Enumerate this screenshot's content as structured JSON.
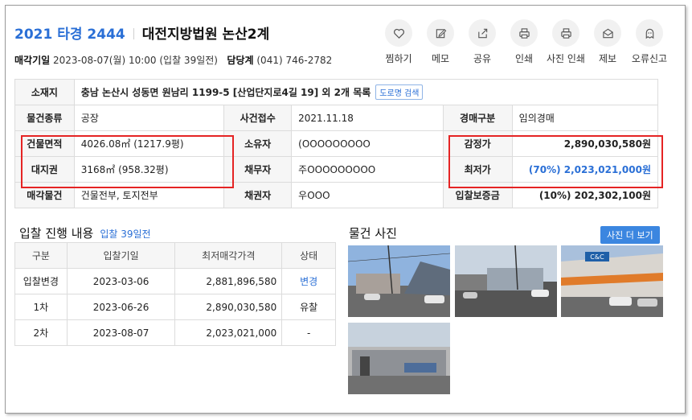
{
  "header": {
    "case_number": "2021 타경 2444",
    "court": "대전지방법원 논산2계",
    "sale_date_label": "매각기일",
    "sale_date_value": "2023-08-07(월) 10:00 (입찰 39일전)",
    "department_label": "담당계",
    "department_phone": "(041) 746-2782"
  },
  "actions": [
    {
      "label": "찜하기",
      "icon": "heart-icon"
    },
    {
      "label": "메모",
      "icon": "pencil-icon"
    },
    {
      "label": "공유",
      "icon": "share-icon"
    },
    {
      "label": "인쇄",
      "icon": "printer-icon"
    },
    {
      "label": "사진 인쇄",
      "icon": "printer-icon"
    },
    {
      "label": "제보",
      "icon": "mail-icon"
    },
    {
      "label": "오류신고",
      "icon": "ghost-icon"
    }
  ],
  "info": {
    "address_label": "소재지",
    "address_value": "충남 논산시 성동면 원남리 1199-5 [산업단지로4길 19] 외 2개 목록",
    "road_button": "도로명 검색",
    "type_label": "물건종류",
    "type_value": "공장",
    "received_label": "사건접수",
    "received_value": "2021.11.18",
    "auction_type_label": "경매구분",
    "auction_type_value": "임의경매",
    "building_label": "건물면적",
    "building_value": "4026.08㎡ (1217.9평)",
    "owner_label": "소유자",
    "owner_value": "(OOOOOOOOO",
    "appraisal_label": "감정가",
    "appraisal_value": "2,890,030,580원",
    "land_label": "대지권",
    "land_value": "3168㎡ (958.32평)",
    "debtor_label": "채무자",
    "debtor_value": "주OOOOOOOOO",
    "minimum_label": "최저가",
    "minimum_value": "(70%) 2,023,021,000원",
    "sale_item_label": "매각물건",
    "sale_item_value": "건물전부, 토지전부",
    "creditor_label": "채권자",
    "creditor_value": "우OOO",
    "deposit_label": "입찰보증금",
    "deposit_value": "(10%) 202,302,100원"
  },
  "history": {
    "title": "입찰 진행 내용",
    "days": "입찰 39일전",
    "headers": [
      "구분",
      "입찰기일",
      "최저매각가격",
      "상태"
    ],
    "rows": [
      [
        "입찰변경",
        "2023-03-06",
        "2,881,896,580",
        "변경"
      ],
      [
        "1차",
        "2023-06-26",
        "2,890,030,580",
        "유찰"
      ],
      [
        "2차",
        "2023-08-07",
        "2,023,021,000",
        "-"
      ]
    ]
  },
  "photos": {
    "title": "물건 사진",
    "more_button": "사진 더 보기",
    "sign_text": "C&C"
  },
  "colors": {
    "accent": "#2a6fd6",
    "highlight_box": "#e52424"
  }
}
